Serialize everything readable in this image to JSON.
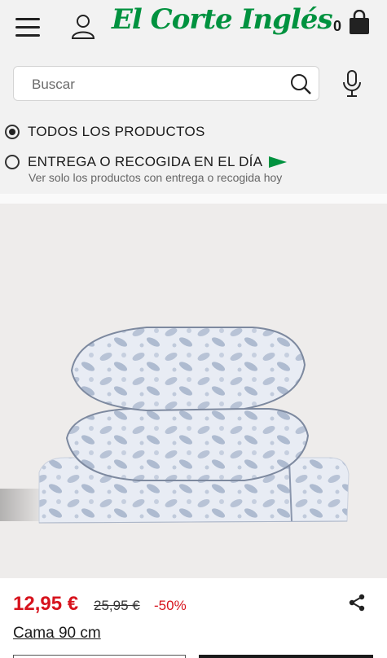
{
  "header": {
    "logo_text": "El Corte Inglés",
    "cart_count": "0"
  },
  "search": {
    "placeholder": "Buscar"
  },
  "filters": {
    "all_products_label": "TODOS LOS PRODUCTOS",
    "same_day_label": "ENTREGA O RECOGIDA EN EL DÍA",
    "same_day_sub": "Ver solo los productos con entrega o recogida hoy",
    "selected": "all_products"
  },
  "product": {
    "price_current": "12,95 €",
    "price_old": "25,95 €",
    "discount": "-50%",
    "size_label": "Cama 90 cm"
  },
  "colors": {
    "brand_green": "#00923f",
    "sale_red": "#d7131d"
  }
}
